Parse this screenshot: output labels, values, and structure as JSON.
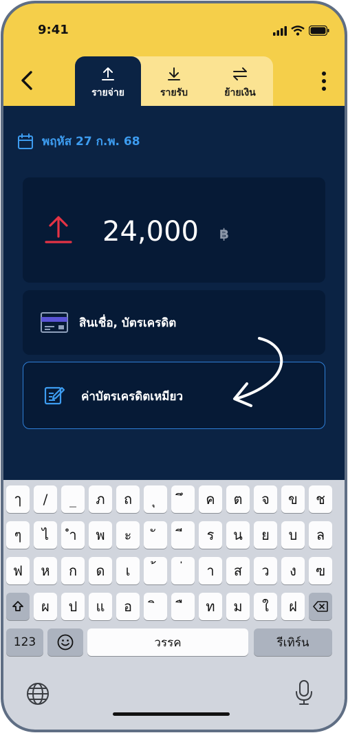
{
  "status": {
    "time": "9:41"
  },
  "tabs": [
    {
      "label": "รายจ่าย",
      "icon": "upload-icon",
      "active": true
    },
    {
      "label": "รายรับ",
      "icon": "download-icon",
      "active": false
    },
    {
      "label": "ย้ายเงิน",
      "icon": "transfer-icon",
      "active": false
    }
  ],
  "date": {
    "label": "พฤหัส 27 ก.พ. 68",
    "icon": "calendar-icon"
  },
  "amount": {
    "value": "24,000",
    "currency": "฿",
    "icon": "expense-arrow-icon"
  },
  "category": {
    "label": "สินเชื่อ, บัตรเครดิต",
    "icon": "credit-card-icon"
  },
  "note": {
    "label": "ค่าบัตรเครดิตเหมียว",
    "icon": "edit-note-icon"
  },
  "keyboard": {
    "row1": [
      "ๅ",
      "/",
      "_",
      "ภ",
      "ถ",
      "ุ",
      "ึ",
      "ค",
      "ต",
      "จ",
      "ข",
      "ช"
    ],
    "row2": [
      "ๆ",
      "ไ",
      "ำ",
      "พ",
      "ะ",
      "ั",
      "ี",
      "ร",
      "น",
      "ย",
      "บ",
      "ล"
    ],
    "row3": [
      "ฟ",
      "ห",
      "ก",
      "ด",
      "เ",
      "้",
      "่",
      "า",
      "ส",
      "ว",
      "ง",
      "ฃ"
    ],
    "row4": [
      "ผ",
      "ป",
      "แ",
      "อ",
      "ิ",
      "ื",
      "ท",
      "ม",
      "ใ",
      "ฝ"
    ],
    "numbers_label": "123",
    "space_label": "วรรค",
    "return_label": "รีเทิร์น"
  },
  "colors": {
    "accent_yellow": "#f5cf4a",
    "background_navy": "#0b2344",
    "expense_red": "#e53345",
    "link_blue": "#3d9cf0"
  }
}
